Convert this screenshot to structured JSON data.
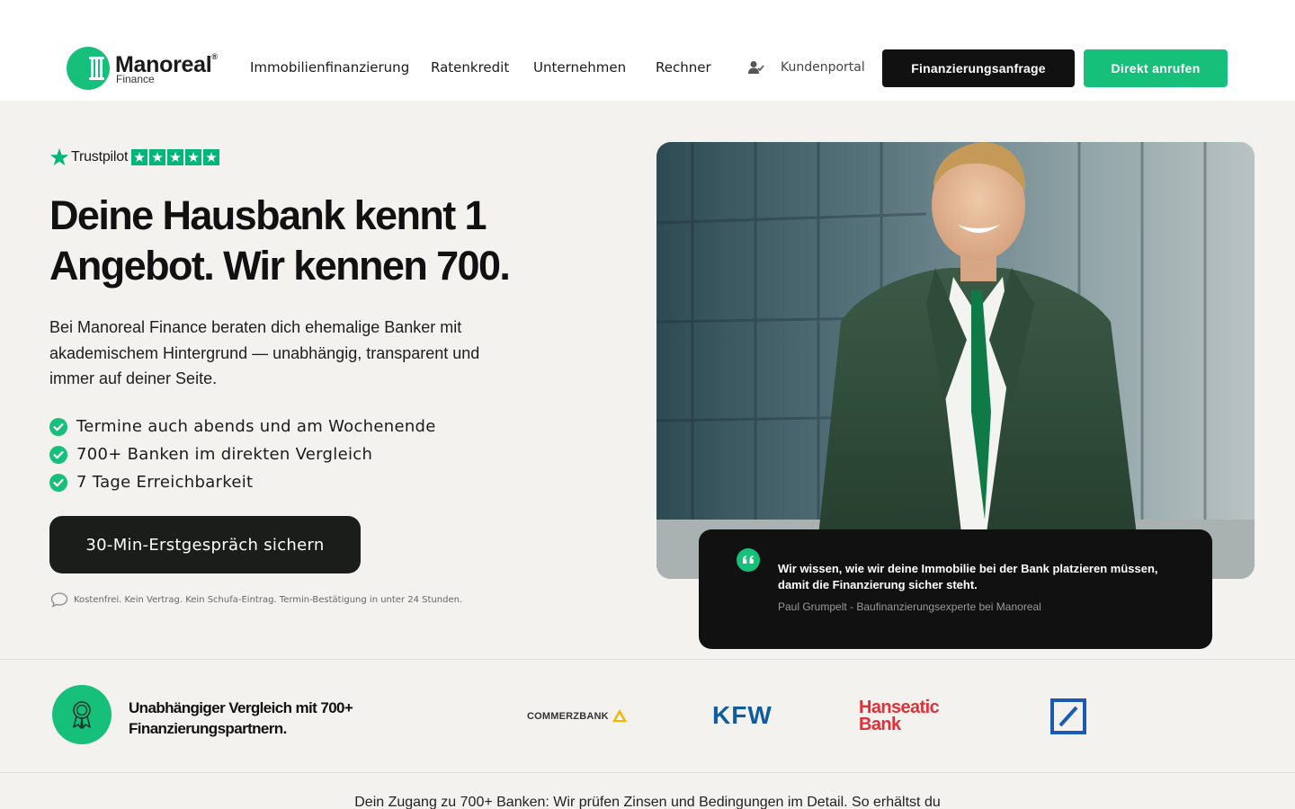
{
  "brand": {
    "name": "Manoreal",
    "registered": "®",
    "subtitle": "Finance",
    "accent_color": "#17c07a",
    "dark_color": "#111111"
  },
  "nav": {
    "items": [
      {
        "label": "Immobilienfinanzierung"
      },
      {
        "label": "Ratenkredit"
      },
      {
        "label": "Unternehmen"
      },
      {
        "label": "Rechner"
      }
    ],
    "portal_label": "Kundenportal",
    "portal_icon": "user-check-icon",
    "primary_button": "Finanzierungsanfrage",
    "call_button": "Direkt anrufen"
  },
  "hero": {
    "rating_source": "Trustpilot",
    "rating_stars": 5,
    "headline_line1": "Deine Hausbank kennt 1",
    "headline_line2": "Angebot. Wir kennen 700.",
    "intro": "Bei Manoreal Finance beraten dich ehemalige Banker mit akademischem Hintergrund — unabhängig, transparent und immer auf deiner Seite.",
    "benefits": [
      "Termine auch abends und am Wochenende",
      "700+ Banken im direkten Vergleich",
      "7 Tage Erreichbarkeit"
    ],
    "cta_label": "30-Min-Erstgespräch sichern",
    "cta_note": "Kostenfrei. Kein Vertrag. Kein Schufa-Eintrag. Termin-Bestätigung in unter 24 Stunden."
  },
  "testimonial": {
    "quote": "Wir wissen, wie wir deine Immobilie bei der Bank platzieren müssen, damit die Finanzierung sicher steht.",
    "author": "Paul Grumpelt - Baufinanzierungsexperte bei Manoreal"
  },
  "partners": {
    "badge_text": "Unabhängiger Vergleich mit 700+ Finanzierungspartnern.",
    "badge_icon": "award-ribbon-icon",
    "logos": [
      {
        "name": "COMMERZBANK",
        "color": "#333333"
      },
      {
        "name": "KFW",
        "color": "#0f5c9e"
      },
      {
        "name_line1": "Hanseatic",
        "name_line2": "Bank",
        "color": "#e0313a"
      },
      {
        "name": "deutsche-bank-logo",
        "color": "#1b5bb5"
      }
    ]
  },
  "next_section": {
    "intro_text": "Dein Zugang zu 700+ Banken: Wir prüfen Zinsen und Bedingungen im Detail. So erhältst du"
  }
}
